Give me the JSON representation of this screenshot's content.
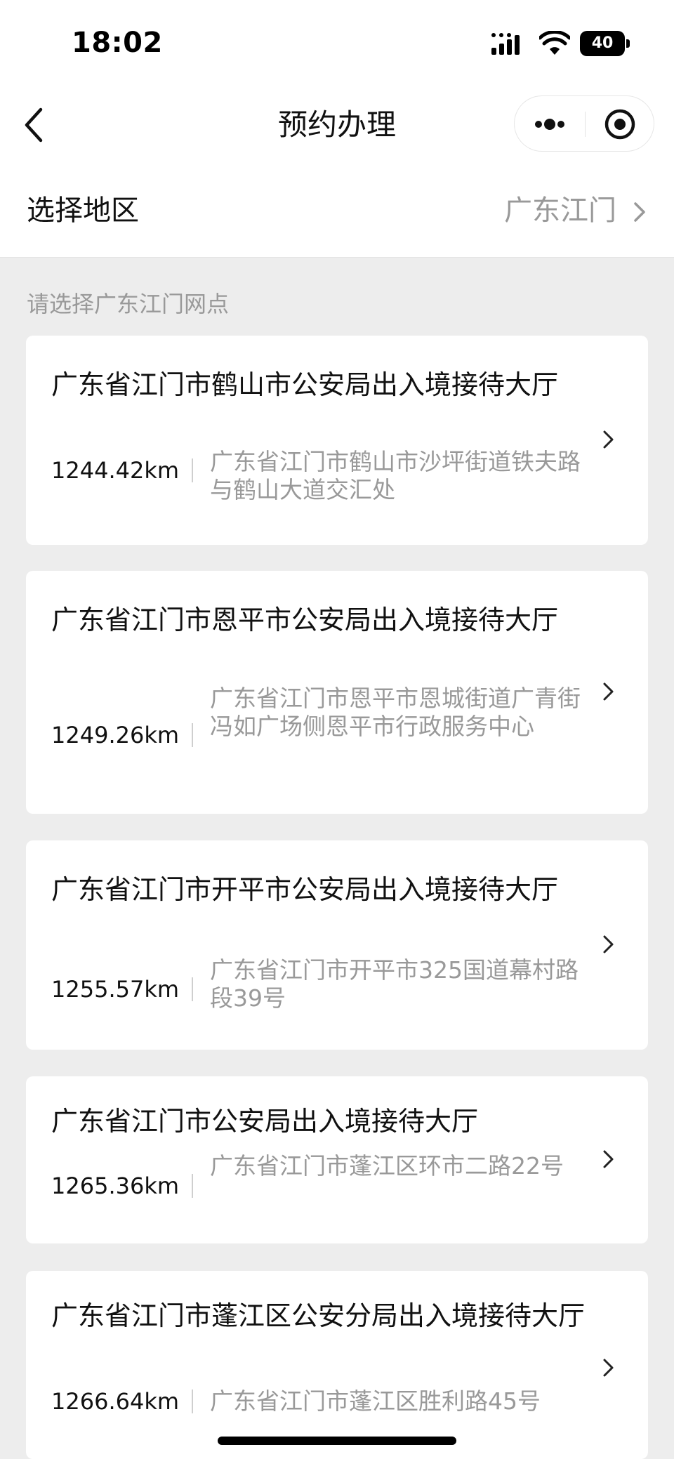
{
  "status_bar": {
    "time": "18:02",
    "battery": "40"
  },
  "nav": {
    "title": "预约办理"
  },
  "region": {
    "label": "选择地区",
    "value": "广东江门"
  },
  "section_hint": "请选择广东江门网点",
  "offices": [
    {
      "name": "广东省江门市鹤山市公安局出入境接待大厅",
      "distance": "1244.42km",
      "address": "广东省江门市鹤山市沙坪街道铁夫路与鹤山大道交汇处"
    },
    {
      "name": "广东省江门市恩平市公安局出入境接待大厅",
      "distance": "1249.26km",
      "address": "广东省江门市恩平市恩城街道广青街冯如广场侧恩平市行政服务中心"
    },
    {
      "name": "广东省江门市开平市公安局出入境接待大厅",
      "distance": "1255.57km",
      "address": "广东省江门市开平市325国道幕村路段39号"
    },
    {
      "name": "广东省江门市公安局出入境接待大厅",
      "distance": "1265.36km",
      "address": "广东省江门市蓬江区环市二路22号"
    },
    {
      "name": "广东省江门市蓬江区公安分局出入境接待大厅",
      "distance": "1266.64km",
      "address": "广东省江门市蓬江区胜利路45号"
    }
  ]
}
